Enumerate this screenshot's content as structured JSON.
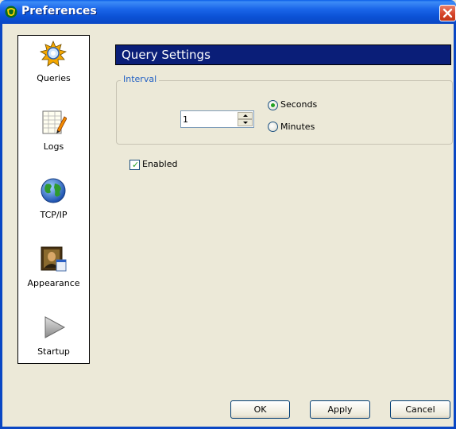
{
  "window": {
    "title": "Preferences",
    "title_icon": "app-shield-icon",
    "close_icon": "close-icon"
  },
  "sidebar": {
    "items": [
      {
        "label": "Queries",
        "icon": "gear-sun-icon",
        "selected": true
      },
      {
        "label": "Logs",
        "icon": "notepad-pencil-icon",
        "selected": false
      },
      {
        "label": "TCP/IP",
        "icon": "globe-icon",
        "selected": false
      },
      {
        "label": "Appearance",
        "icon": "portrait-painting-icon",
        "selected": false
      },
      {
        "label": "Startup",
        "icon": "play-arrow-icon",
        "selected": false
      }
    ]
  },
  "main": {
    "header": "Query Settings",
    "interval": {
      "legend": "Interval",
      "value": "1",
      "options": [
        {
          "label": "Seconds",
          "selected": true
        },
        {
          "label": "Minutes",
          "selected": false
        }
      ]
    },
    "enabled": {
      "label": "Enabled",
      "checked": true
    }
  },
  "buttons": {
    "ok": "OK",
    "apply": "Apply",
    "cancel": "Cancel"
  },
  "colors": {
    "header_bg": "#0a1e78",
    "legend_text": "#2160c4",
    "window_bg": "#ECE9D8",
    "titlebar_blue": "#0b52d6"
  }
}
